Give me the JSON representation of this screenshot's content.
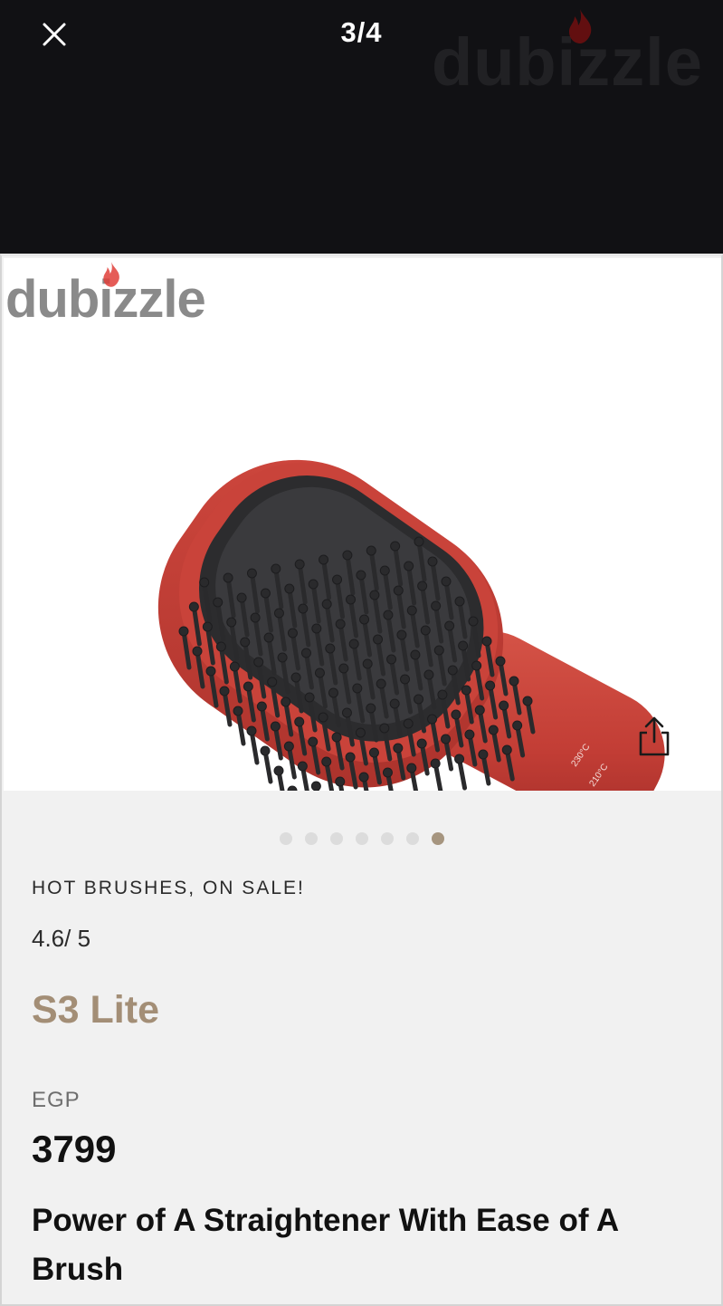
{
  "viewer": {
    "counter": "3/4",
    "watermark": "dubizzle",
    "icons": {
      "close": "close-icon",
      "share": "share-icon",
      "flame": "flame-icon"
    }
  },
  "listing": {
    "watermark": "dubizzle",
    "carousel": {
      "total_slides": 7,
      "active_index": 6
    },
    "category": "HOT BRUSHES,  ON SALE!",
    "rating": "4.6/ 5",
    "model": "S3 Lite",
    "currency": "EGP",
    "price": "3799",
    "tagline": "Power of A Straightener With Ease of A Brush",
    "product_labels": {
      "temp_high": "230°C",
      "temp_low": "210°C"
    }
  },
  "colors": {
    "viewer_bg": "#111114",
    "accent": "#a38e76",
    "product_red": "#c9433a",
    "dubizzle_red": "#e0403a"
  }
}
